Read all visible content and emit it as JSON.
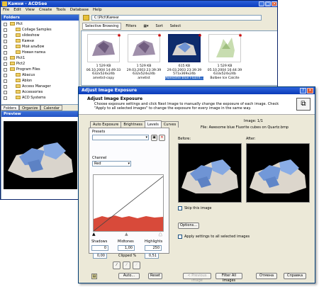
{
  "main": {
    "title": "Камни - ACDSee",
    "menu": [
      "File",
      "Edit",
      "View",
      "Create",
      "Tools",
      "Database",
      "Help"
    ],
    "folders_label": "Folders",
    "tree": [
      {
        "label": "Pict",
        "indent": 1
      },
      {
        "label": "Collage Samples",
        "indent": 2
      },
      {
        "label": "slideshow",
        "indent": 2
      },
      {
        "label": "Камни",
        "indent": 2
      },
      {
        "label": "Мой альбом",
        "indent": 2
      },
      {
        "label": "Новая папка",
        "indent": 2
      },
      {
        "label": "Pict1",
        "indent": 1
      },
      {
        "label": "Pict2",
        "indent": 1
      },
      {
        "label": "Program Files",
        "indent": 1
      },
      {
        "label": "Abacus",
        "indent": 2
      },
      {
        "label": "Ablon",
        "indent": 2
      },
      {
        "label": "Access Manager",
        "indent": 2
      },
      {
        "label": "Accessories",
        "indent": 2
      },
      {
        "label": "ACD Systems",
        "indent": 2
      }
    ],
    "panel_tabs": [
      "Folders",
      "Organize",
      "Calendar"
    ],
    "preview_label": "Preview",
    "path": "C:\\Pict\\Камни",
    "toolbar": [
      "Selective Browsing",
      "Filters",
      "Sort",
      "Select"
    ],
    "thumbs": [
      {
        "size": "1 529 KB",
        "date": "06.10.2004 14:49:33",
        "dims": "632x524x24b",
        "name": "ametist-copy"
      },
      {
        "size": "1 529 KB",
        "date": "29.03.2003 23:39:39",
        "dims": "632x524x24b",
        "name": "ametist"
      },
      {
        "size": "615 KB",
        "date": "29.03.2003 23:39:39",
        "dims": "571x369x24b",
        "name": "Awesome blue Fluorit..."
      },
      {
        "size": "1 529 KB",
        "date": "05.10.2004 16:44:39",
        "dims": "633x524x24b",
        "name": "Bolbee Ice Calcite"
      }
    ]
  },
  "dialog": {
    "title": "Adjust Image Exposure",
    "subtitle": "Adjust Image Exposure",
    "description": "Choose exposure settings and click Next Image to manually change the exposure of each image. Check \"Apply to all selected images\" to change the exposure for every image in the same way.",
    "tabs": [
      "Auto Exposure",
      "Brightness",
      "Levels",
      "Curves"
    ],
    "presets_label": "Presets",
    "channel_label": "Channel",
    "channel_value": "Red",
    "shadows_label": "Shadows",
    "midtones_label": "Midtones",
    "highlights_label": "Highlights",
    "shadows_value": "0",
    "midtones_value": "1,00",
    "highlights_value": "250",
    "clipped_left": "0,00",
    "clipped_label": "Clipped %",
    "clipped_right": "0,51",
    "auto_button": "Auto...",
    "reset_button": "Reset",
    "image_counter": "Image: 1/1",
    "file_label": "File: Awesome blue Fluorite cubes on Quartz.bmp",
    "before_label": "Before:",
    "after_label": "After:",
    "skip_label": "Skip this image",
    "options_button": "Options...",
    "apply_all_label": "Apply settings to all selected images",
    "prev_button": "< Previous Image",
    "filter_button": "Filter All Images",
    "cancel_button": "Отмена",
    "help_button": "Справка"
  }
}
